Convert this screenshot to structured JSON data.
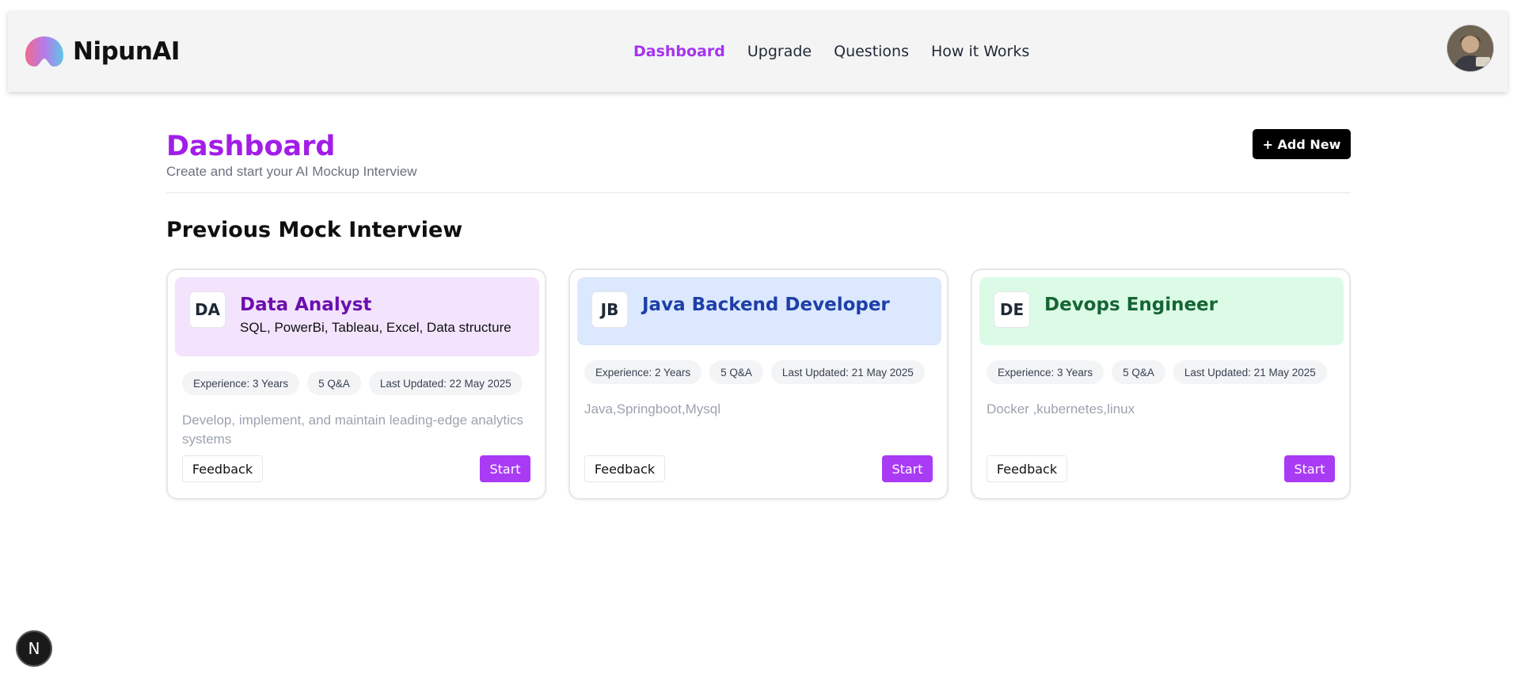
{
  "app": {
    "name": "NipunAI"
  },
  "nav": {
    "items": [
      "Dashboard",
      "Upgrade",
      "Questions",
      "How it Works"
    ],
    "active": "Dashboard"
  },
  "header": {
    "avatar_icon": "user-avatar"
  },
  "page": {
    "title": "Dashboard",
    "subtitle": "Create and start your AI Mockup Interview",
    "add_button": "+ Add New",
    "section_title": "Previous Mock Interview"
  },
  "colors": {
    "accent": "#a21ee8",
    "start_button": "#a93bf5"
  },
  "cards": [
    {
      "initials": "DA",
      "title": "Data Analyst",
      "skills": "SQL, PowerBi, Tableau, Excel, Data structure",
      "head_bg": "#f3e3fd",
      "title_color": "#6b0fae",
      "tags": [
        "Experience: 3 Years",
        "5 Q&A",
        "Last Updated: 22 May 2025"
      ],
      "description": "Develop, implement, and maintain leading-edge analytics systems",
      "feedback_label": "Feedback",
      "start_label": "Start"
    },
    {
      "initials": "JB",
      "title": "Java Backend Developer",
      "skills": "",
      "head_bg": "#dbe8fe",
      "title_color": "#1e3fa8",
      "tags": [
        "Experience: 2 Years",
        "5 Q&A",
        "Last Updated: 21 May 2025"
      ],
      "description": "Java,Springboot,Mysql",
      "feedback_label": "Feedback",
      "start_label": "Start"
    },
    {
      "initials": "DE",
      "title": "Devops Engineer",
      "skills": "",
      "head_bg": "#dbfbe6",
      "title_color": "#166534",
      "tags": [
        "Experience: 3 Years",
        "5 Q&A",
        "Last Updated: 21 May 2025"
      ],
      "description": "Docker ,kubernetes,linux",
      "feedback_label": "Feedback",
      "start_label": "Start"
    }
  ],
  "dev_badge": {
    "label": "N"
  }
}
